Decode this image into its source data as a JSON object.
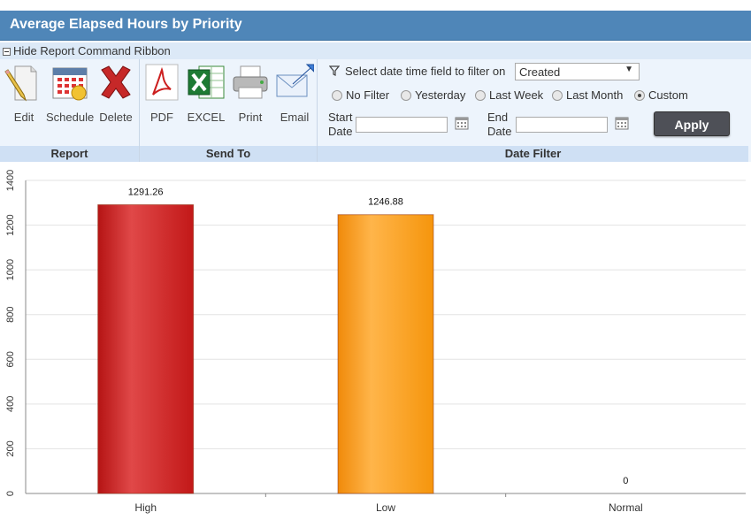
{
  "title": "Average Elapsed Hours by Priority",
  "ribbon_toggle_label": "Hide Report Command Ribbon",
  "groups": {
    "report": {
      "title": "Report",
      "buttons": [
        {
          "label": "Edit",
          "icon": "edit-icon"
        },
        {
          "label": "Schedule",
          "icon": "calendar-icon"
        },
        {
          "label": "Delete",
          "icon": "delete-icon"
        }
      ]
    },
    "send_to": {
      "title": "Send To",
      "buttons": [
        {
          "label": "PDF",
          "icon": "pdf-icon"
        },
        {
          "label": "EXCEL",
          "icon": "excel-icon"
        },
        {
          "label": "Print",
          "icon": "printer-icon"
        },
        {
          "label": "Email",
          "icon": "email-icon"
        }
      ]
    },
    "date_filter": {
      "title": "Date Filter",
      "field_label": "Select date time field to filter on",
      "field_value": "Created",
      "radios": [
        {
          "label": "No Filter",
          "checked": false
        },
        {
          "label": "Yesterday",
          "checked": false
        },
        {
          "label": "Last Week",
          "checked": false
        },
        {
          "label": "Last Month",
          "checked": false
        },
        {
          "label": "Custom",
          "checked": true
        }
      ],
      "start_label": "Start Date",
      "end_label": "End Date",
      "start_value": "",
      "end_value": "",
      "apply_label": "Apply"
    }
  },
  "colors": {
    "title_bar": "#4f86b8",
    "high": "#cc1f1f",
    "low": "#f59c1a"
  },
  "chart_data": {
    "type": "bar",
    "categories": [
      "High",
      "Low",
      "Normal"
    ],
    "values": [
      1291.26,
      1246.88,
      0
    ],
    "data_labels": [
      "1291.26",
      "1246.88",
      "0"
    ],
    "colors": [
      "#cc1f1f",
      "#f59c1a",
      "#888888"
    ],
    "ylim": [
      0,
      1400
    ],
    "yticks": [
      0,
      200,
      400,
      600,
      800,
      1000,
      1200,
      1400
    ],
    "grid": true
  }
}
